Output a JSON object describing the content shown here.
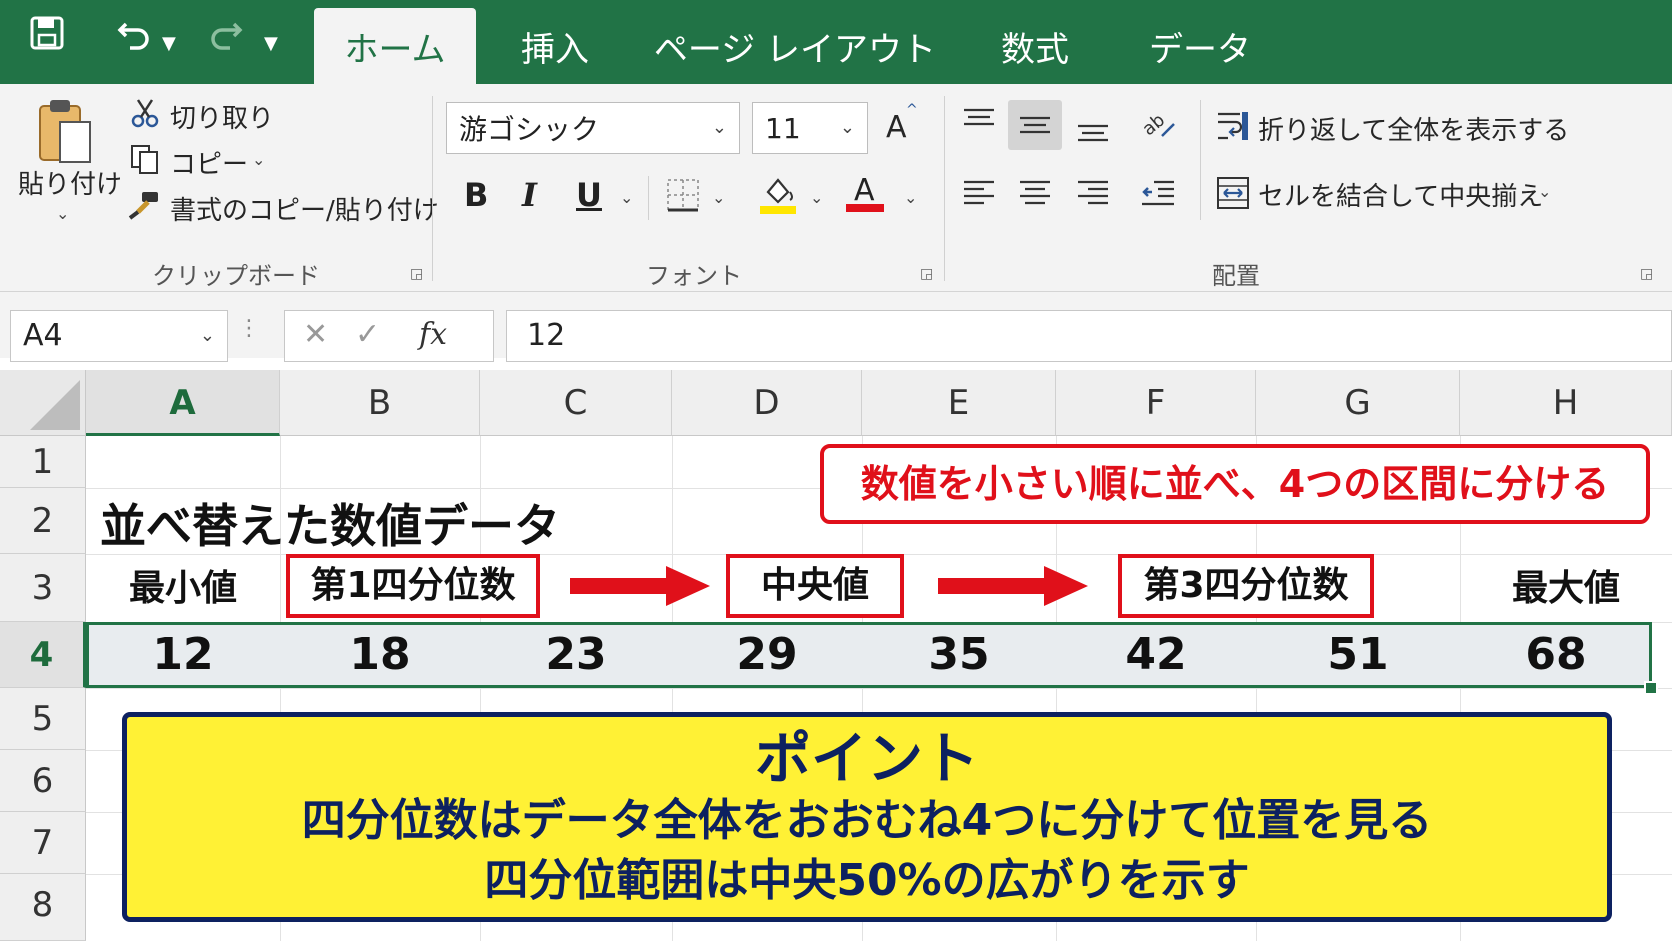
{
  "ribbon_tabs": [
    "ホーム",
    "挿入",
    "ページ レイアウト",
    "数式",
    "データ"
  ],
  "clipboard": {
    "paste": "貼り付け",
    "cut": "切り取り",
    "copy": "コピー",
    "format_painter": "書式のコピー/貼り付け",
    "group": "クリップボード"
  },
  "font": {
    "name": "游ゴシック",
    "size": "11",
    "grow": "A",
    "bold": "B",
    "italic": "I",
    "underline": "U",
    "font_color": "A",
    "group": "フォント",
    "fill_color": "#ffe600",
    "text_color": "#e0101a"
  },
  "alignment": {
    "wrap": "折り返して全体を表示する",
    "merge": "セルを結合して中央揃え",
    "group": "配置"
  },
  "formula_bar": {
    "name_box": "A4",
    "fx": "fx",
    "formula": "12"
  },
  "columns": [
    "A",
    "B",
    "C",
    "D",
    "E",
    "F",
    "G",
    "H"
  ],
  "rows": [
    "1",
    "2",
    "3",
    "4",
    "5",
    "6",
    "7",
    "8"
  ],
  "sheet": {
    "title": "並べ替えた数値データ",
    "callout": "数値を小さい順に並べ、4つの区間に分ける",
    "min_label": "最小値",
    "q1_label": "第1四分位数",
    "median_label": "中央値",
    "q3_label": "第3四分位数",
    "max_label": "最大値",
    "values": [
      "12",
      "18",
      "23",
      "29",
      "35",
      "42",
      "51",
      "68"
    ],
    "accent": "#e0101a",
    "selection_color": "#217346"
  },
  "point_box": {
    "title": "ポイント",
    "line1": "四分位数はデータ全体をおおむね4つに分けて位置を見る",
    "line2": "四分位範囲は中央50%の広がりを示す",
    "bg": "#fff135",
    "border": "#0d2160"
  }
}
